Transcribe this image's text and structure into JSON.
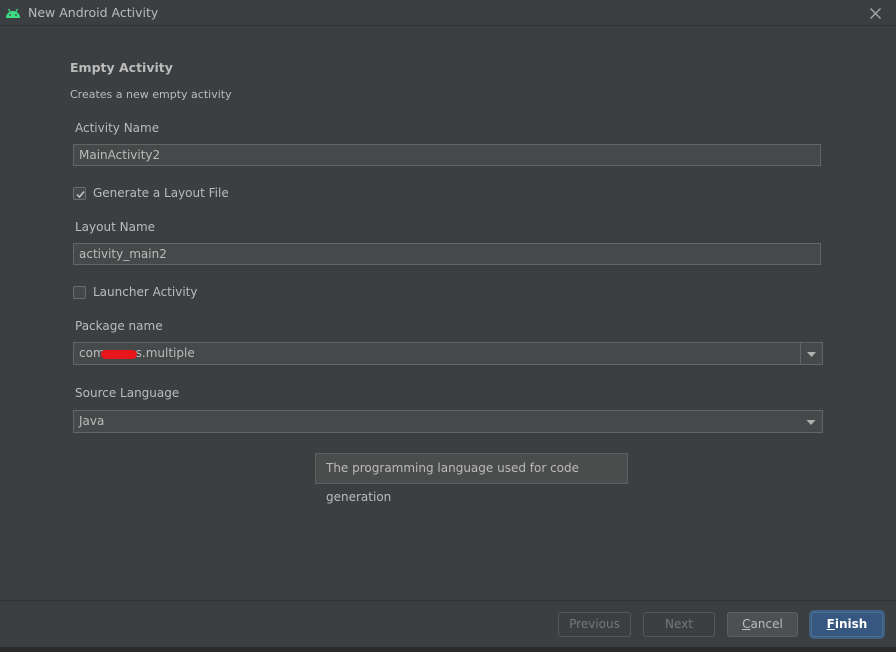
{
  "window": {
    "title": "New Android Activity",
    "icon": "android-icon",
    "close_icon": "close-icon"
  },
  "template": {
    "title": "Empty Activity",
    "description": "Creates a new empty activity"
  },
  "fields": {
    "activity_name": {
      "label": "Activity Name",
      "value": "MainActivity2"
    },
    "generate_layout": {
      "label": "Generate a Layout File",
      "checked": true
    },
    "layout_name": {
      "label": "Layout Name",
      "value": "activity_main2"
    },
    "launcher_activity": {
      "label": "Launcher Activity",
      "checked": false
    },
    "package_name": {
      "label": "Package name",
      "value_prefix": "com",
      "value_suffix": "s.multiple"
    },
    "source_language": {
      "label": "Source Language",
      "value": "Java"
    }
  },
  "tooltip": {
    "text": "The programming language used for code generation"
  },
  "buttons": {
    "previous": "Previous",
    "next": "Next",
    "cancel_mnemonic": "C",
    "cancel_rest": "ancel",
    "finish_mnemonic": "F",
    "finish_rest": "inish"
  },
  "colors": {
    "background": "#3c3f41",
    "input_bg": "#45494a",
    "primary_button": "#365880",
    "android_green": "#3ddc84",
    "redaction": "#e8161b"
  }
}
